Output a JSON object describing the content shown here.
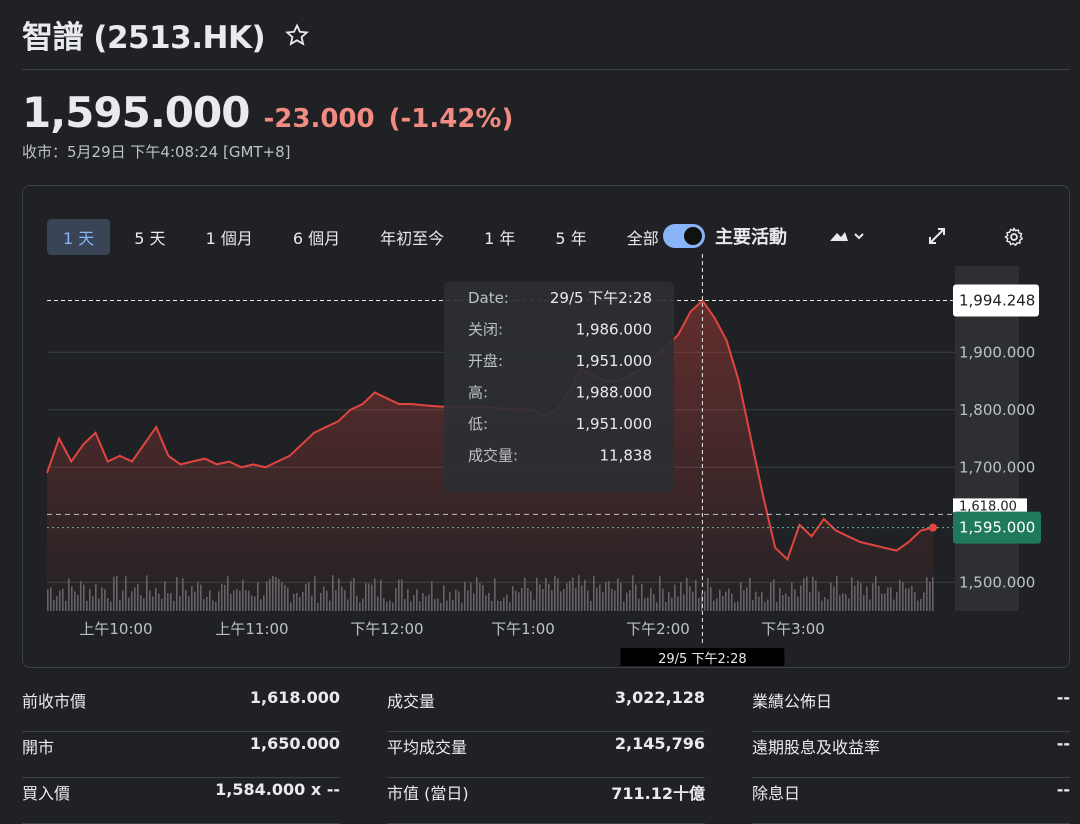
{
  "header": {
    "title": "智譜 (2513.HK)",
    "price": "1,595.000",
    "change": "-23.000",
    "change_pct": "(-1.42%)",
    "close_info": "收市：5月29日 下午4:08:24 [GMT+8]"
  },
  "range_tabs": [
    "1 天",
    "5 天",
    "1 個月",
    "6 個月",
    "年初至今",
    "1 年",
    "5 年",
    "全部"
  ],
  "active_range": "1 天",
  "toggle": {
    "label": "主要活動",
    "on": true
  },
  "colors": {
    "accent": "#8ab4f8",
    "line": "#e0453f",
    "down": "#f28b82",
    "current_price_tag": "#1e7a5a"
  },
  "chart_data": {
    "type": "line",
    "x_tick_labels": [
      "上午10:00",
      "上午11:00",
      "下午12:00",
      "下午1:00",
      "下午2:00",
      "下午3:00"
    ],
    "y_tick_labels": [
      "1,900.000",
      "1,800.000",
      "1,700.000",
      "1,500.000"
    ],
    "ylim": [
      1450,
      2050
    ],
    "previous_close": 1618,
    "current_price_label": "1,595.000",
    "crosshair_price_label": "1,994.248",
    "crosshair_time_label": "29/5 下午2:28",
    "previous_close_tag": "1,618.00",
    "series": [
      {
        "values": [
          1690,
          1750,
          1710,
          1740,
          1760,
          1710,
          1720,
          1710,
          1740,
          1770,
          1720,
          1705,
          1710,
          1715,
          1705,
          1710,
          1700,
          1705,
          1700,
          1710,
          1720,
          1740,
          1760,
          1770,
          1780,
          1800,
          1810,
          1830,
          1820,
          1810,
          1810,
          1808,
          1806,
          1805,
          1804,
          1804,
          1805,
          1803,
          1802,
          1800,
          1800,
          1790,
          1800,
          1830,
          1870,
          1860,
          1850,
          1850,
          1860,
          1870,
          1890,
          1910,
          1930,
          1970,
          1990,
          1960,
          1920,
          1850,
          1750,
          1650,
          1560,
          1540,
          1600,
          1580,
          1610,
          1590,
          1580,
          1570,
          1565,
          1560,
          1555,
          1570,
          1590,
          1595
        ]
      }
    ],
    "tooltip": {
      "rows": [
        {
          "label": "Date:",
          "value": "29/5 下午2:28"
        },
        {
          "label": "关闭:",
          "value": "1,986.000"
        },
        {
          "label": "开盘:",
          "value": "1,951.000"
        },
        {
          "label": "高:",
          "value": "1,988.000"
        },
        {
          "label": "低:",
          "value": "1,951.000"
        },
        {
          "label": "成交量:",
          "value": "11,838"
        }
      ]
    }
  },
  "stats": [
    [
      {
        "label": "前收市價",
        "value": "1,618.000"
      },
      {
        "label": "開市",
        "value": "1,650.000"
      },
      {
        "label": "買入價",
        "value": "1,584.000 x --"
      }
    ],
    [
      {
        "label": "成交量",
        "value": "3,022,128"
      },
      {
        "label": "平均成交量",
        "value": "2,145,796"
      },
      {
        "label": "市值 (當日)",
        "value": "711.12十億"
      }
    ],
    [
      {
        "label": "業績公佈日",
        "value": "--"
      },
      {
        "label": "遠期股息及收益率",
        "value": "--"
      },
      {
        "label": "除息日",
        "value": "--"
      }
    ]
  ]
}
